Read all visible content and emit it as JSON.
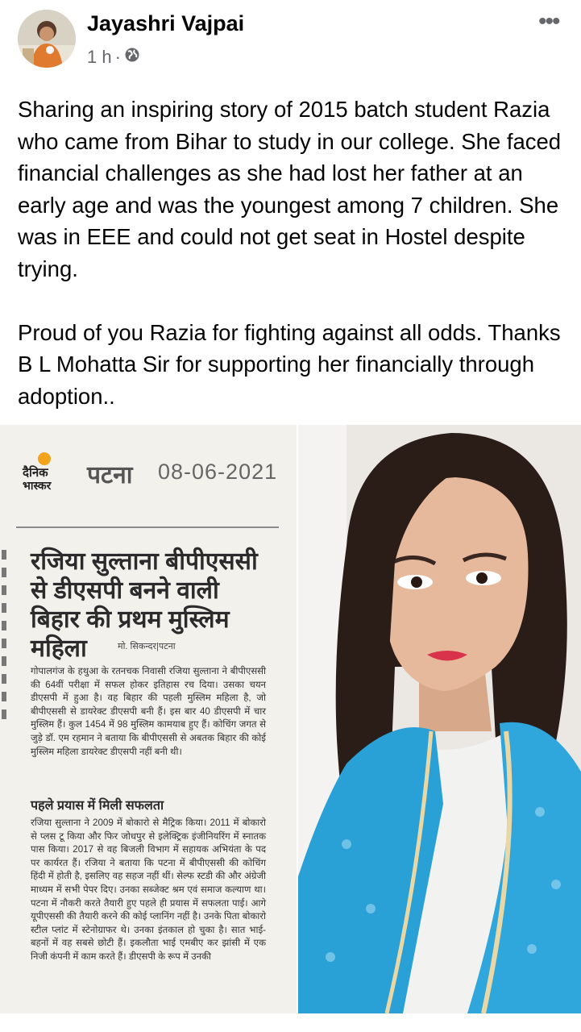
{
  "post": {
    "author": "Jayashri Vajpai",
    "time": "1 h",
    "dot": "·",
    "privacy_icon": "globe-icon",
    "more_label": "•••",
    "text": "Sharing an inspiring story of 2015 batch student Razia who came from Bihar to study in our college. She faced financial challenges as she had lost her father at an early age and was the youngest among 7 children. She was in EEE and could not get seat in Hostel despite  trying.\n\nProud of you Razia for fighting against all odds. Thanks B L Mohatta Sir for supporting her financially through adoption.."
  },
  "clipping": {
    "logo_text_1": "दैनिक",
    "logo_text_2": "भास्कर",
    "place": "पटना",
    "date": "08-06-2021",
    "headline": "रजिया सुल्ताना बीपीएससी से डीएसपी बनने वाली बिहार की प्रथम मुस्लिम महिला",
    "byline": "मो. सिकन्दर|पटना",
    "para1": "गोपालगंज के हथुआ के रतनचक निवासी रजिया सुल्ताना ने बीपीएससी की 64वीं परीक्षा में सफल होकर इतिहास रच दिया। उसका चयन डीएसपी में हुआ है। वह बिहार की पहली मुस्लिम महिला है, जो बीपीएससी से डायरेक्ट डीएसपी बनी हैं। इस बार 40 डीएसपी में चार मुस्लिम हैं। कुल 1454 में 98 मुस्लिम कामयाब हुए हैं। कोचिंग जगत से जुड़े डॉ. एम रहमान ने बताया कि बीपीएससी से अबतक बिहार की कोई मुस्लिम महिला डायरेक्ट डीएसपी नहीं बनी थी।",
    "subhead": "पहले प्रयास में मिली सफलता",
    "para2": "रजिया सुल्ताना ने 2009 में बोकारो से मैट्रिक किया। 2011 में बोकारो से प्लस टू किया और फिर जोधपुर से इलेक्ट्रिक इंजीनियरिंग में स्नातक पास किया। 2017 से वह बिजली विभाग में सहायक अभियंता के पद पर कार्यरत हैं। रजिया ने बताया कि पटना में बीपीएससी की कोचिंग हिंदी में होती है, इसलिए वह सहज नहीं थीं। सेल्फ स्टडी की और अंग्रेजी माध्यम में सभी पेपर दिए। उनका सब्जेक्ट श्रम एवं समाज कल्याण था। पटना में नौकरी करते तैयारी हुए पहले ही प्रयास में सफलता पाई। आगे यूपीएससी की तैयारी करने की कोई प्लानिंग नहीं है। उनके पिता बोकारो स्टील प्लांट में स्टेनोग्राफर थे। उनका इंतकाल हो चुका है। सात भाई-बहनों में वह सबसे छोटी हैं। इकलौता भाई एमबीए कर झांसी में एक निजी कंपनी में काम करते हैं। डीएसपी के रूप में उनकी"
  }
}
